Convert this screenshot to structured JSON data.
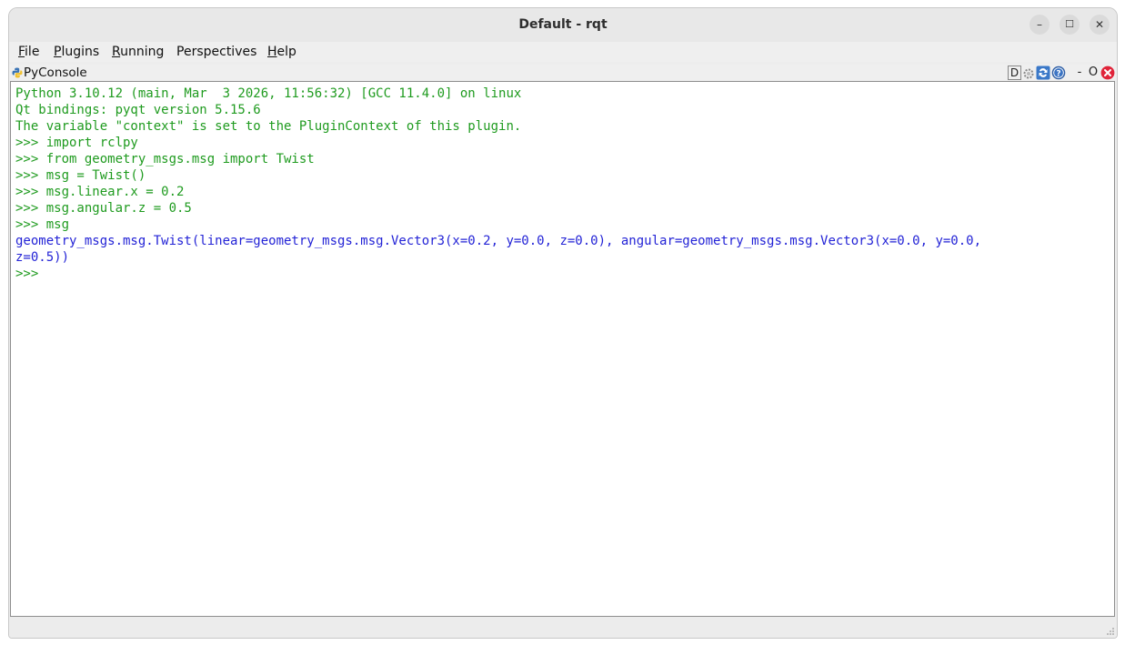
{
  "window": {
    "title": "Default - rqt",
    "min_label": "–",
    "max_label": "☐",
    "close_label": "✕"
  },
  "menubar": [
    {
      "first": "F",
      "rest": "ile"
    },
    {
      "first": "P",
      "rest": "lugins"
    },
    {
      "first": "R",
      "rest": "unning"
    },
    {
      "first": "P",
      "rest": "erspectives",
      "pre": ""
    },
    {
      "first": "H",
      "rest": "elp"
    }
  ],
  "menu_labels": {
    "file": "File",
    "plugins": "Plugins",
    "running": "Running",
    "perspectives": "Perspectives",
    "help": "Help"
  },
  "dock": {
    "title": "PyConsole",
    "d_label": "D",
    "minimize_label": "-",
    "float_label": "O"
  },
  "console": {
    "lines": [
      {
        "text": "Python 3.10.12 (main, Mar  3 2026, 11:56:32) [GCC 11.4.0] on linux",
        "color": "green"
      },
      {
        "text": "Qt bindings: pyqt version 5.15.6",
        "color": "green"
      },
      {
        "text": "The variable \"context\" is set to the PluginContext of this plugin.",
        "color": "green"
      },
      {
        "text": ">>> import rclpy",
        "color": "green"
      },
      {
        "text": ">>> from geometry_msgs.msg import Twist",
        "color": "green"
      },
      {
        "text": ">>> msg = Twist()",
        "color": "green"
      },
      {
        "text": ">>> msg.linear.x = 0.2",
        "color": "green"
      },
      {
        "text": ">>> msg.angular.z = 0.5",
        "color": "green"
      },
      {
        "text": ">>> msg",
        "color": "green"
      },
      {
        "text": "geometry_msgs.msg.Twist(linear=geometry_msgs.msg.Vector3(x=0.2, y=0.0, z=0.0), angular=geometry_msgs.msg.Vector3(x=0.0, y=0.0,",
        "color": "blue"
      },
      {
        "text": "z=0.5))",
        "color": "blue"
      },
      {
        "text": ">>>",
        "color": "green"
      }
    ]
  },
  "colors": {
    "prompt_text": "#1f9b1f",
    "output_text": "#2323d6",
    "close_red": "#e0243a"
  }
}
